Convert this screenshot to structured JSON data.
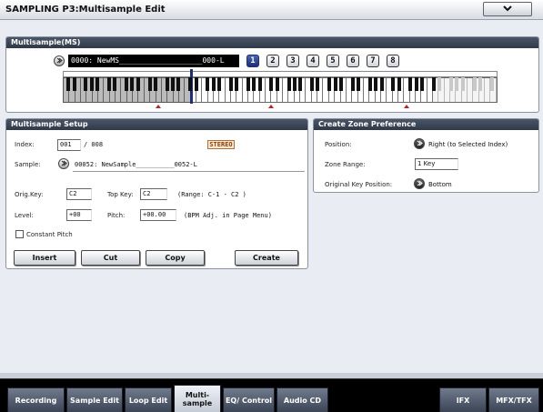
{
  "window": {
    "title": "SAMPLING P3:Multisample Edit",
    "menu_icon": "chevron-down-icon"
  },
  "multisample": {
    "header": "Multisample(MS)",
    "name": "0000: NewMS___________________000-L",
    "buttons": [
      "1",
      "2",
      "3",
      "4",
      "5",
      "6",
      "7",
      "8"
    ],
    "selected": "1"
  },
  "setup": {
    "header": "Multisample Setup",
    "index_label": "Index:",
    "index_value": "001",
    "index_total": "/ 008",
    "stereo_badge": "STEREO",
    "sample_label": "Sample:",
    "sample_value": "00052: NewSample__________0052-L",
    "orig_key_label": "Orig.Key:",
    "orig_key_value": "C2",
    "top_key_label": "Top Key:",
    "top_key_value": "C2",
    "range_text": "(Range:  C-1  - C2   )",
    "level_label": "Level:",
    "level_value": "+00",
    "pitch_label": "Pitch:",
    "pitch_value": "+00.00",
    "bpm_text": "(BPM Adj. in Page Menu)",
    "constant_pitch_label": "Constant Pitch",
    "insert_label": "Insert",
    "cut_label": "Cut",
    "copy_label": "Copy",
    "create_label": "Create"
  },
  "preference": {
    "header": "Create Zone Preference",
    "position_label": "Position:",
    "position_value": "Right (to Selected Index)",
    "zone_range_label": "Zone Range:",
    "zone_range_value": "1 Key",
    "orig_key_pos_label": "Original Key Position:",
    "orig_key_pos_value": "Bottom"
  },
  "tabs": [
    {
      "label": "Recording"
    },
    {
      "label": "Sample Edit"
    },
    {
      "label": "Loop Edit"
    },
    {
      "label": "Multi- sample"
    },
    {
      "label": "EQ/ Control"
    },
    {
      "label": "Audio CD"
    },
    {
      "label": "IFX"
    },
    {
      "label": "MFX/TFX"
    }
  ],
  "active_tab": "Multi- sample"
}
